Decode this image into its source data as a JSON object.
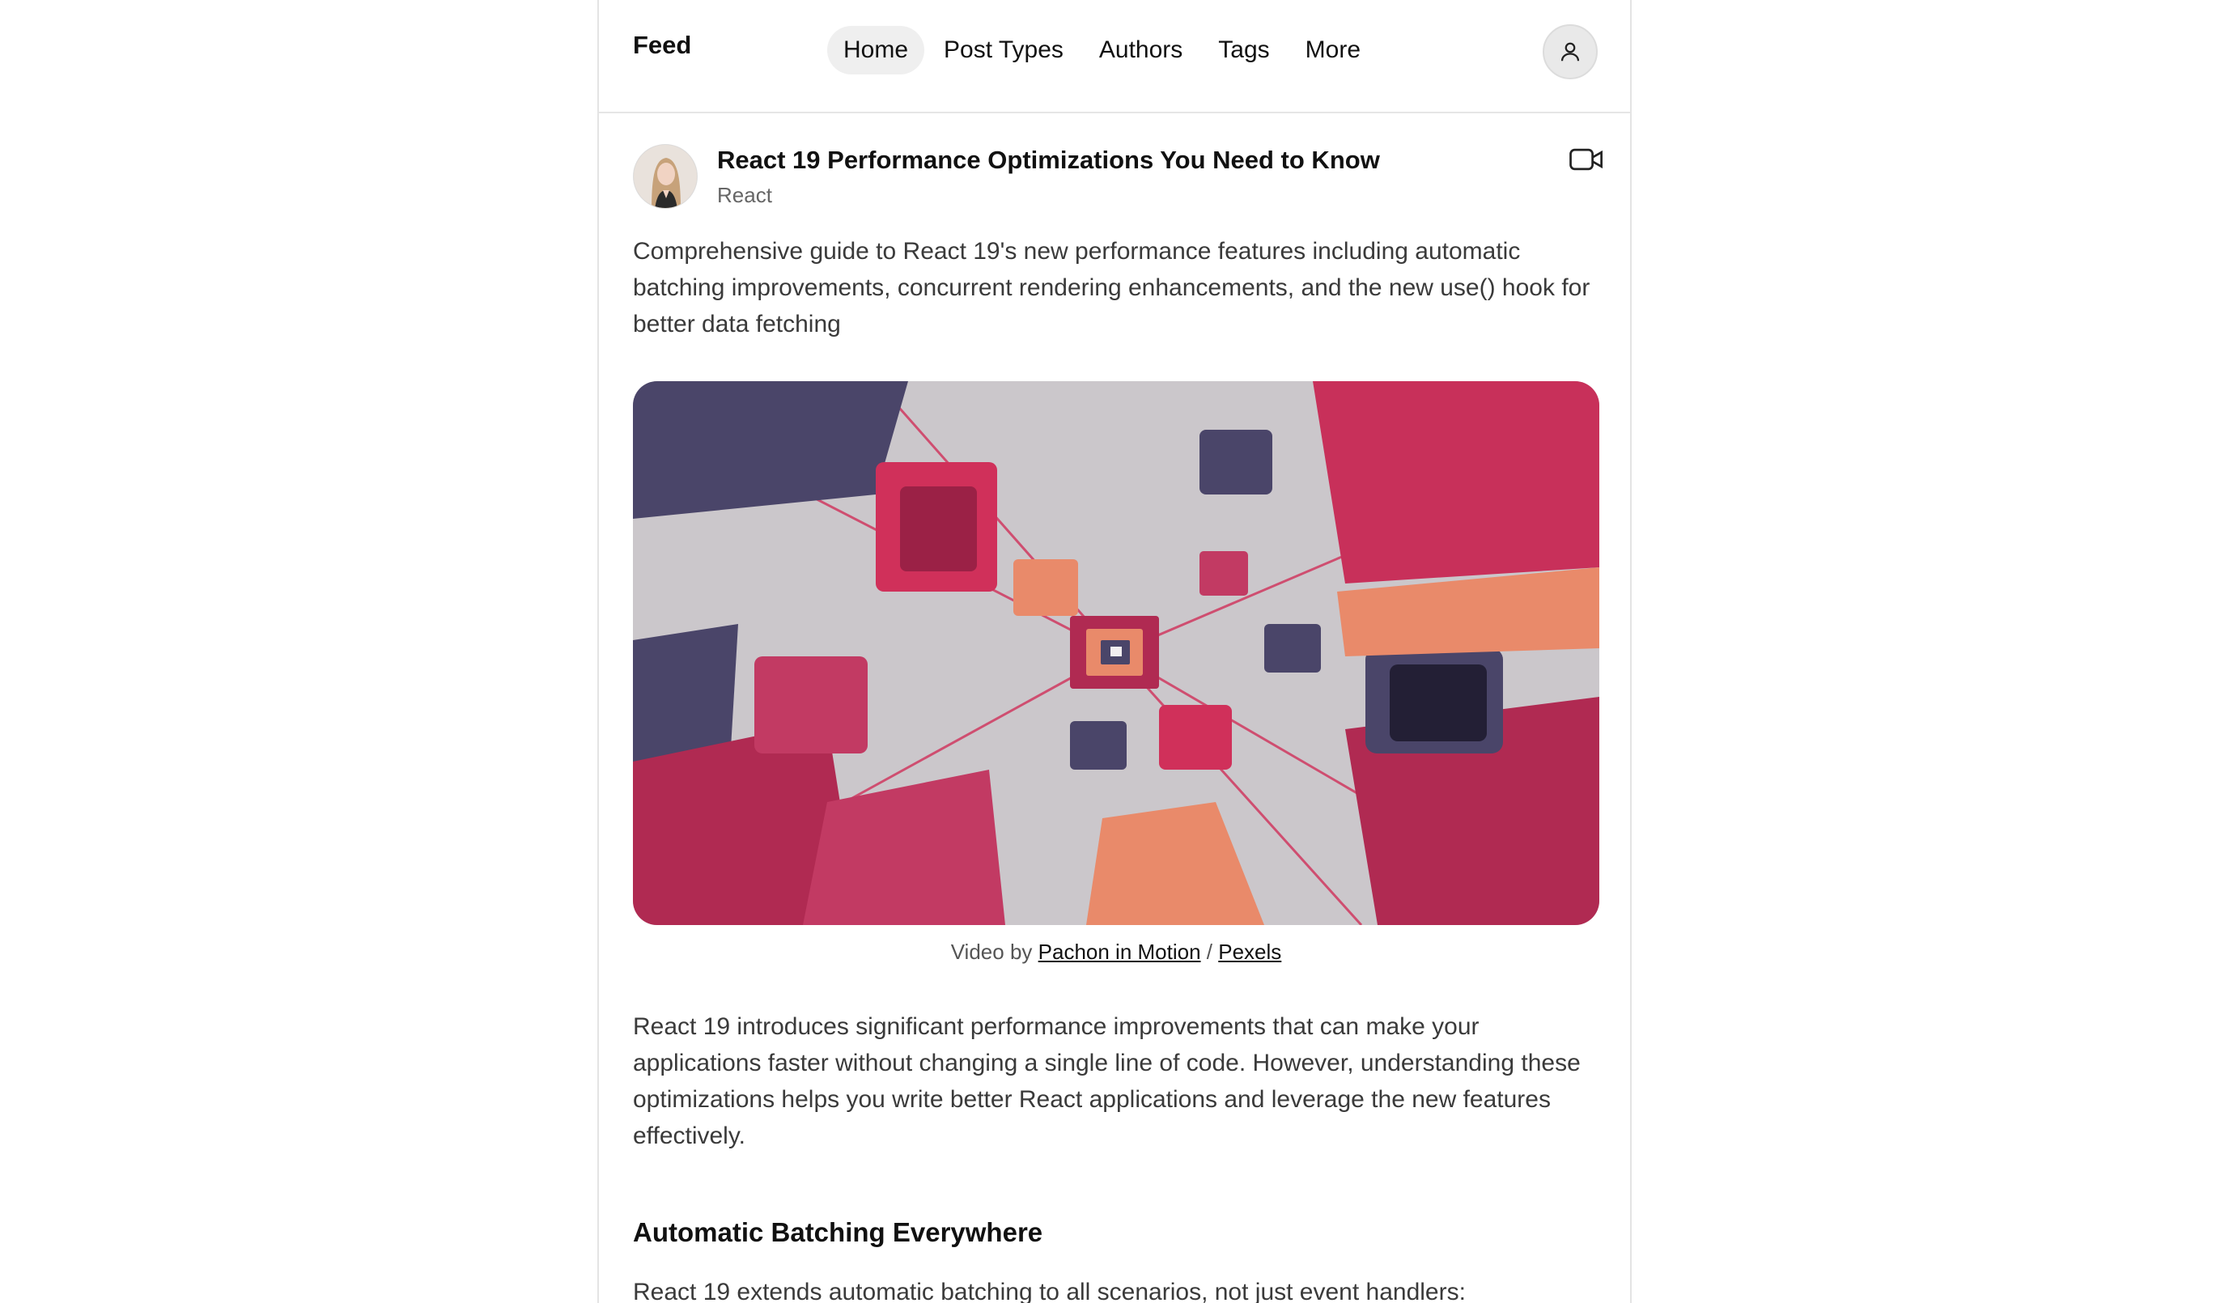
{
  "header": {
    "brand": "Feed",
    "nav": [
      {
        "label": "Home",
        "active": true
      },
      {
        "label": "Post Types",
        "active": false
      },
      {
        "label": "Authors",
        "active": false
      },
      {
        "label": "Tags",
        "active": false
      },
      {
        "label": "More",
        "active": false
      }
    ],
    "profile_icon": "user-icon"
  },
  "post": {
    "title": "React 19 Performance Optimizations You Need to Know",
    "category": "React",
    "type_icon": "video-camera-icon",
    "summary": "Comprehensive guide to React 19's new performance features including automatic batching improvements, concurrent rendering enhancements, and the new use() hook for better data fetching",
    "media": {
      "credit_prefix": "Video by",
      "author": "Pachon in Motion",
      "separator": "/",
      "source": "Pexels"
    },
    "body": "React 19 introduces significant performance improvements that can make your applications faster without changing a single line of code. However, understanding these optimizations helps you write better React applications and leverage the new features effectively.",
    "section_heading": "Automatic Batching Everywhere",
    "section_body": "React 19 extends automatic batching to all scenarios, not just event handlers:"
  },
  "colors": {
    "accent_magenta": "#c8305a",
    "accent_navy": "#4a4569",
    "accent_orange": "#e98a6a",
    "background_gray": "#c8c5c9"
  }
}
